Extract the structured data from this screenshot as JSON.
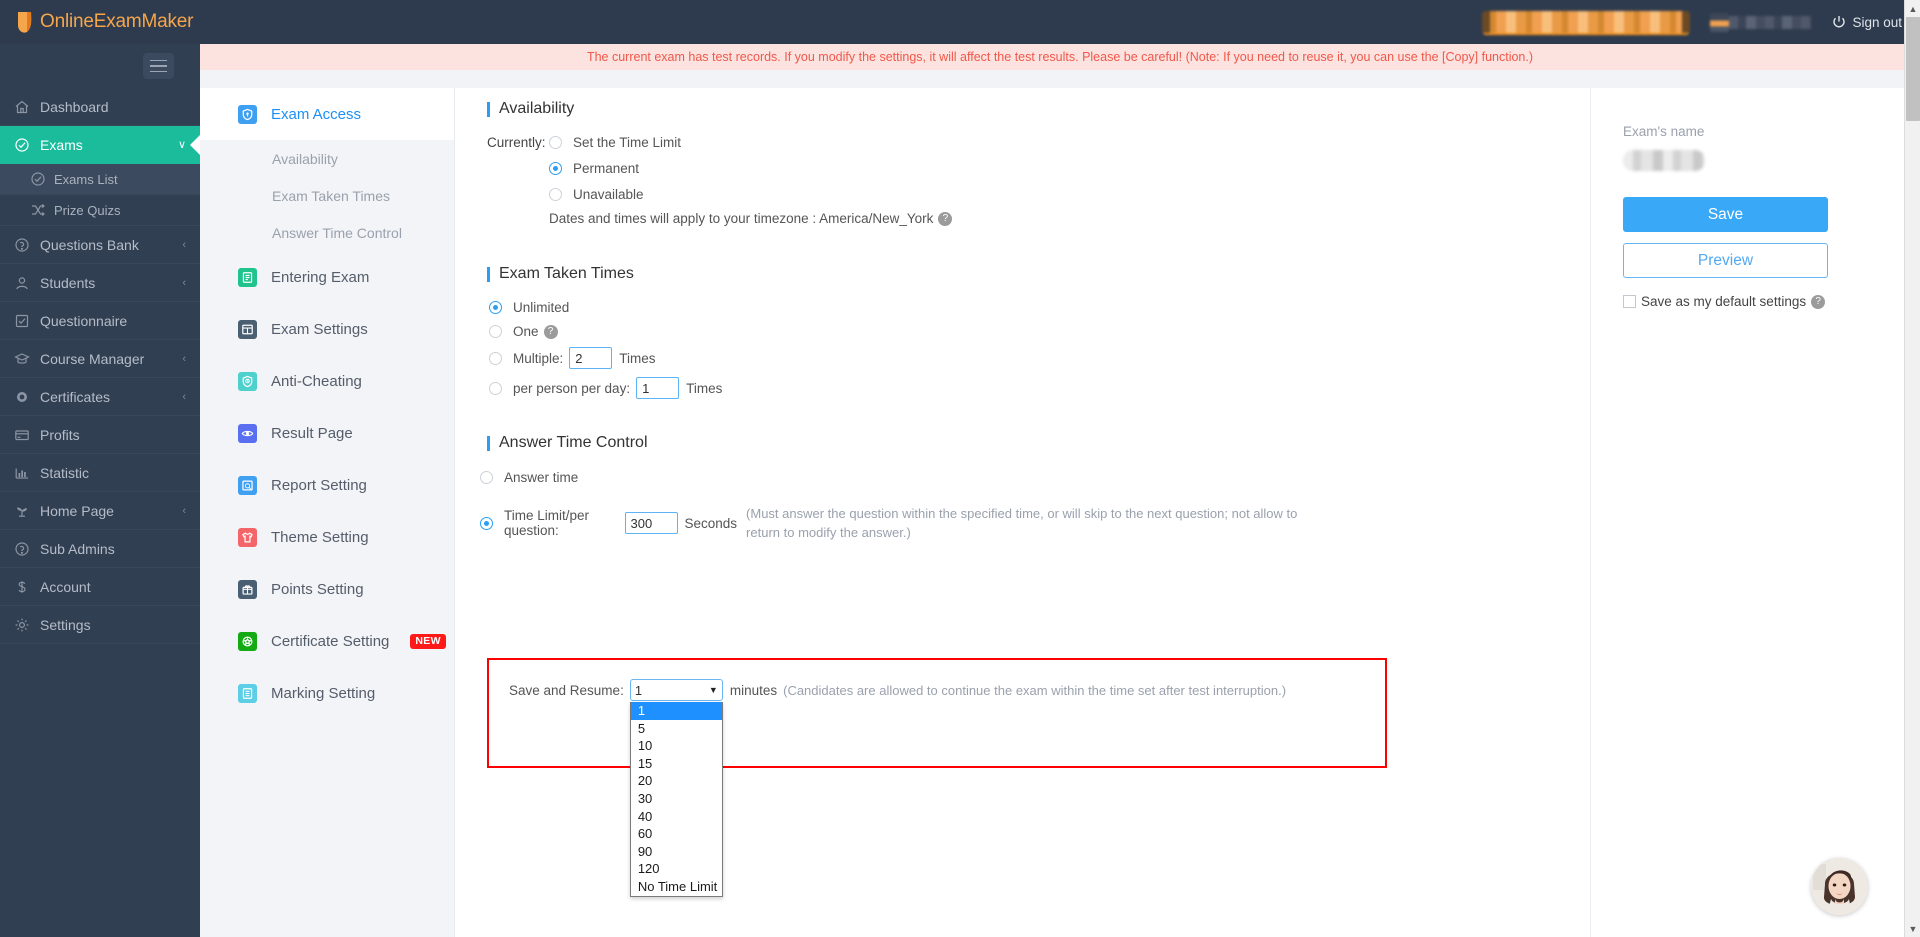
{
  "app": {
    "brand": "OnlineExamMaker",
    "sign_out": "Sign out"
  },
  "warning": {
    "text": "The current exam has test records. If you modify the settings, it will affect the test results. Please be careful! (Note: If you need to reuse it, you can use the [Copy] function.)"
  },
  "sidebar": {
    "items": [
      {
        "label": "Dashboard",
        "icon": "home-icon",
        "caret": "",
        "active": false
      },
      {
        "label": "Exams",
        "icon": "check-circle-icon",
        "caret": "∨",
        "active": true
      },
      {
        "label": "Questions Bank",
        "icon": "question-circle-icon",
        "caret": "‹",
        "active": false
      },
      {
        "label": "Students",
        "icon": "user-icon",
        "caret": "‹",
        "active": false
      },
      {
        "label": "Questionnaire",
        "icon": "checkbox-icon",
        "caret": "",
        "active": false
      },
      {
        "label": "Course Manager",
        "icon": "graduation-cap-icon",
        "caret": "‹",
        "active": false
      },
      {
        "label": "Certificates",
        "icon": "seal-icon",
        "caret": "‹",
        "active": false
      },
      {
        "label": "Profits",
        "icon": "card-icon",
        "caret": "",
        "active": false
      },
      {
        "label": "Statistic",
        "icon": "bar-chart-icon",
        "caret": "",
        "active": false
      },
      {
        "label": "Home Page",
        "icon": "sprout-icon",
        "caret": "‹",
        "active": false
      },
      {
        "label": "Sub Admins",
        "icon": "question-circle-icon",
        "caret": "",
        "active": false
      },
      {
        "label": "Account",
        "icon": "dollar-icon",
        "caret": "",
        "active": false
      },
      {
        "label": "Settings",
        "icon": "gear-icon",
        "caret": "",
        "active": false
      }
    ],
    "subitems": [
      {
        "label": "Exams List",
        "icon": "check-circle-icon",
        "selected": true
      },
      {
        "label": "Prize Quizs",
        "icon": "shuffle-icon",
        "selected": false
      }
    ]
  },
  "secnav": {
    "items": [
      {
        "label": "Exam Access",
        "icon": "shield-access-icon",
        "color": "#3f9ff0",
        "active": true,
        "badge": ""
      },
      {
        "label": "Entering Exam",
        "icon": "enter-icon",
        "color": "#1fc38b",
        "active": false,
        "badge": ""
      },
      {
        "label": "Exam Settings",
        "icon": "layout-icon",
        "color": "#4a5f72",
        "active": false,
        "badge": ""
      },
      {
        "label": "Anti-Cheating",
        "icon": "shield-clock-icon",
        "color": "#4ed0cd",
        "active": false,
        "badge": ""
      },
      {
        "label": "Result Page",
        "icon": "eye-icon",
        "color": "#5a6ff0",
        "active": false,
        "badge": ""
      },
      {
        "label": "Report Setting",
        "icon": "report-icon",
        "color": "#3f9ff0",
        "active": false,
        "badge": ""
      },
      {
        "label": "Theme Setting",
        "icon": "shirt-icon",
        "color": "#f4656a",
        "active": false,
        "badge": ""
      },
      {
        "label": "Points Setting",
        "icon": "gift-icon",
        "color": "#4a5f72",
        "active": false,
        "badge": ""
      },
      {
        "label": "Certificate Setting",
        "icon": "medal-icon",
        "color": "#13aa14",
        "active": false,
        "badge": "NEW"
      },
      {
        "label": "Marking Setting",
        "icon": "marking-icon",
        "color": "#5ccfe6",
        "active": false,
        "badge": ""
      }
    ],
    "subitems": [
      {
        "label": "Availability"
      },
      {
        "label": "Exam Taken Times"
      },
      {
        "label": "Answer Time Control"
      }
    ]
  },
  "main": {
    "availability": {
      "title": "Availability",
      "currently_label": "Currently:",
      "options": [
        {
          "label": "Set the Time Limit",
          "selected": false
        },
        {
          "label": "Permanent",
          "selected": true
        },
        {
          "label": "Unavailable",
          "selected": false
        }
      ],
      "timezone_note": "Dates and times will apply to your timezone : America/New_York"
    },
    "exam_taken_times": {
      "title": "Exam Taken Times",
      "options": [
        {
          "label": "Unlimited",
          "selected": true,
          "help": false,
          "value": "",
          "suffix": ""
        },
        {
          "label": "One",
          "selected": false,
          "help": true,
          "value": "",
          "suffix": ""
        },
        {
          "label": "Multiple:",
          "selected": false,
          "help": false,
          "value": "2",
          "suffix": "Times"
        },
        {
          "label": "per person per day:",
          "selected": false,
          "help": false,
          "value": "1",
          "suffix": "Times"
        }
      ]
    },
    "answer_time_control": {
      "title": "Answer Time Control",
      "option_answer_time": {
        "label": "Answer time",
        "selected": false
      },
      "option_time_limit": {
        "label": "Time Limit/per question:",
        "selected": true,
        "value": "300",
        "unit": "Seconds",
        "hint": "(Must answer the question within the specified time, or will skip to the next question; not allow to return to modify the answer.)"
      }
    },
    "save_and_resume": {
      "label": "Save and Resume:",
      "selected_value": "1",
      "unit": "minutes",
      "hint": "(Candidates are allowed to continue the exam within the time set after test interruption.)",
      "options": [
        "1",
        "5",
        "10",
        "15",
        "20",
        "30",
        "40",
        "60",
        "90",
        "120",
        "No Time Limit"
      ]
    }
  },
  "right_panel": {
    "exam_name_label": "Exam's name",
    "save_label": "Save",
    "preview_label": "Preview",
    "default_settings_label": "Save as my default settings"
  },
  "colors": {
    "accent_blue": "#39a8f7",
    "sidebar_active_green": "#1abc9c",
    "warning_bg": "#fde3e0",
    "warning_text": "#f0584a",
    "highlight_red": "#ff0000",
    "brand_orange": "#f5a54a"
  }
}
